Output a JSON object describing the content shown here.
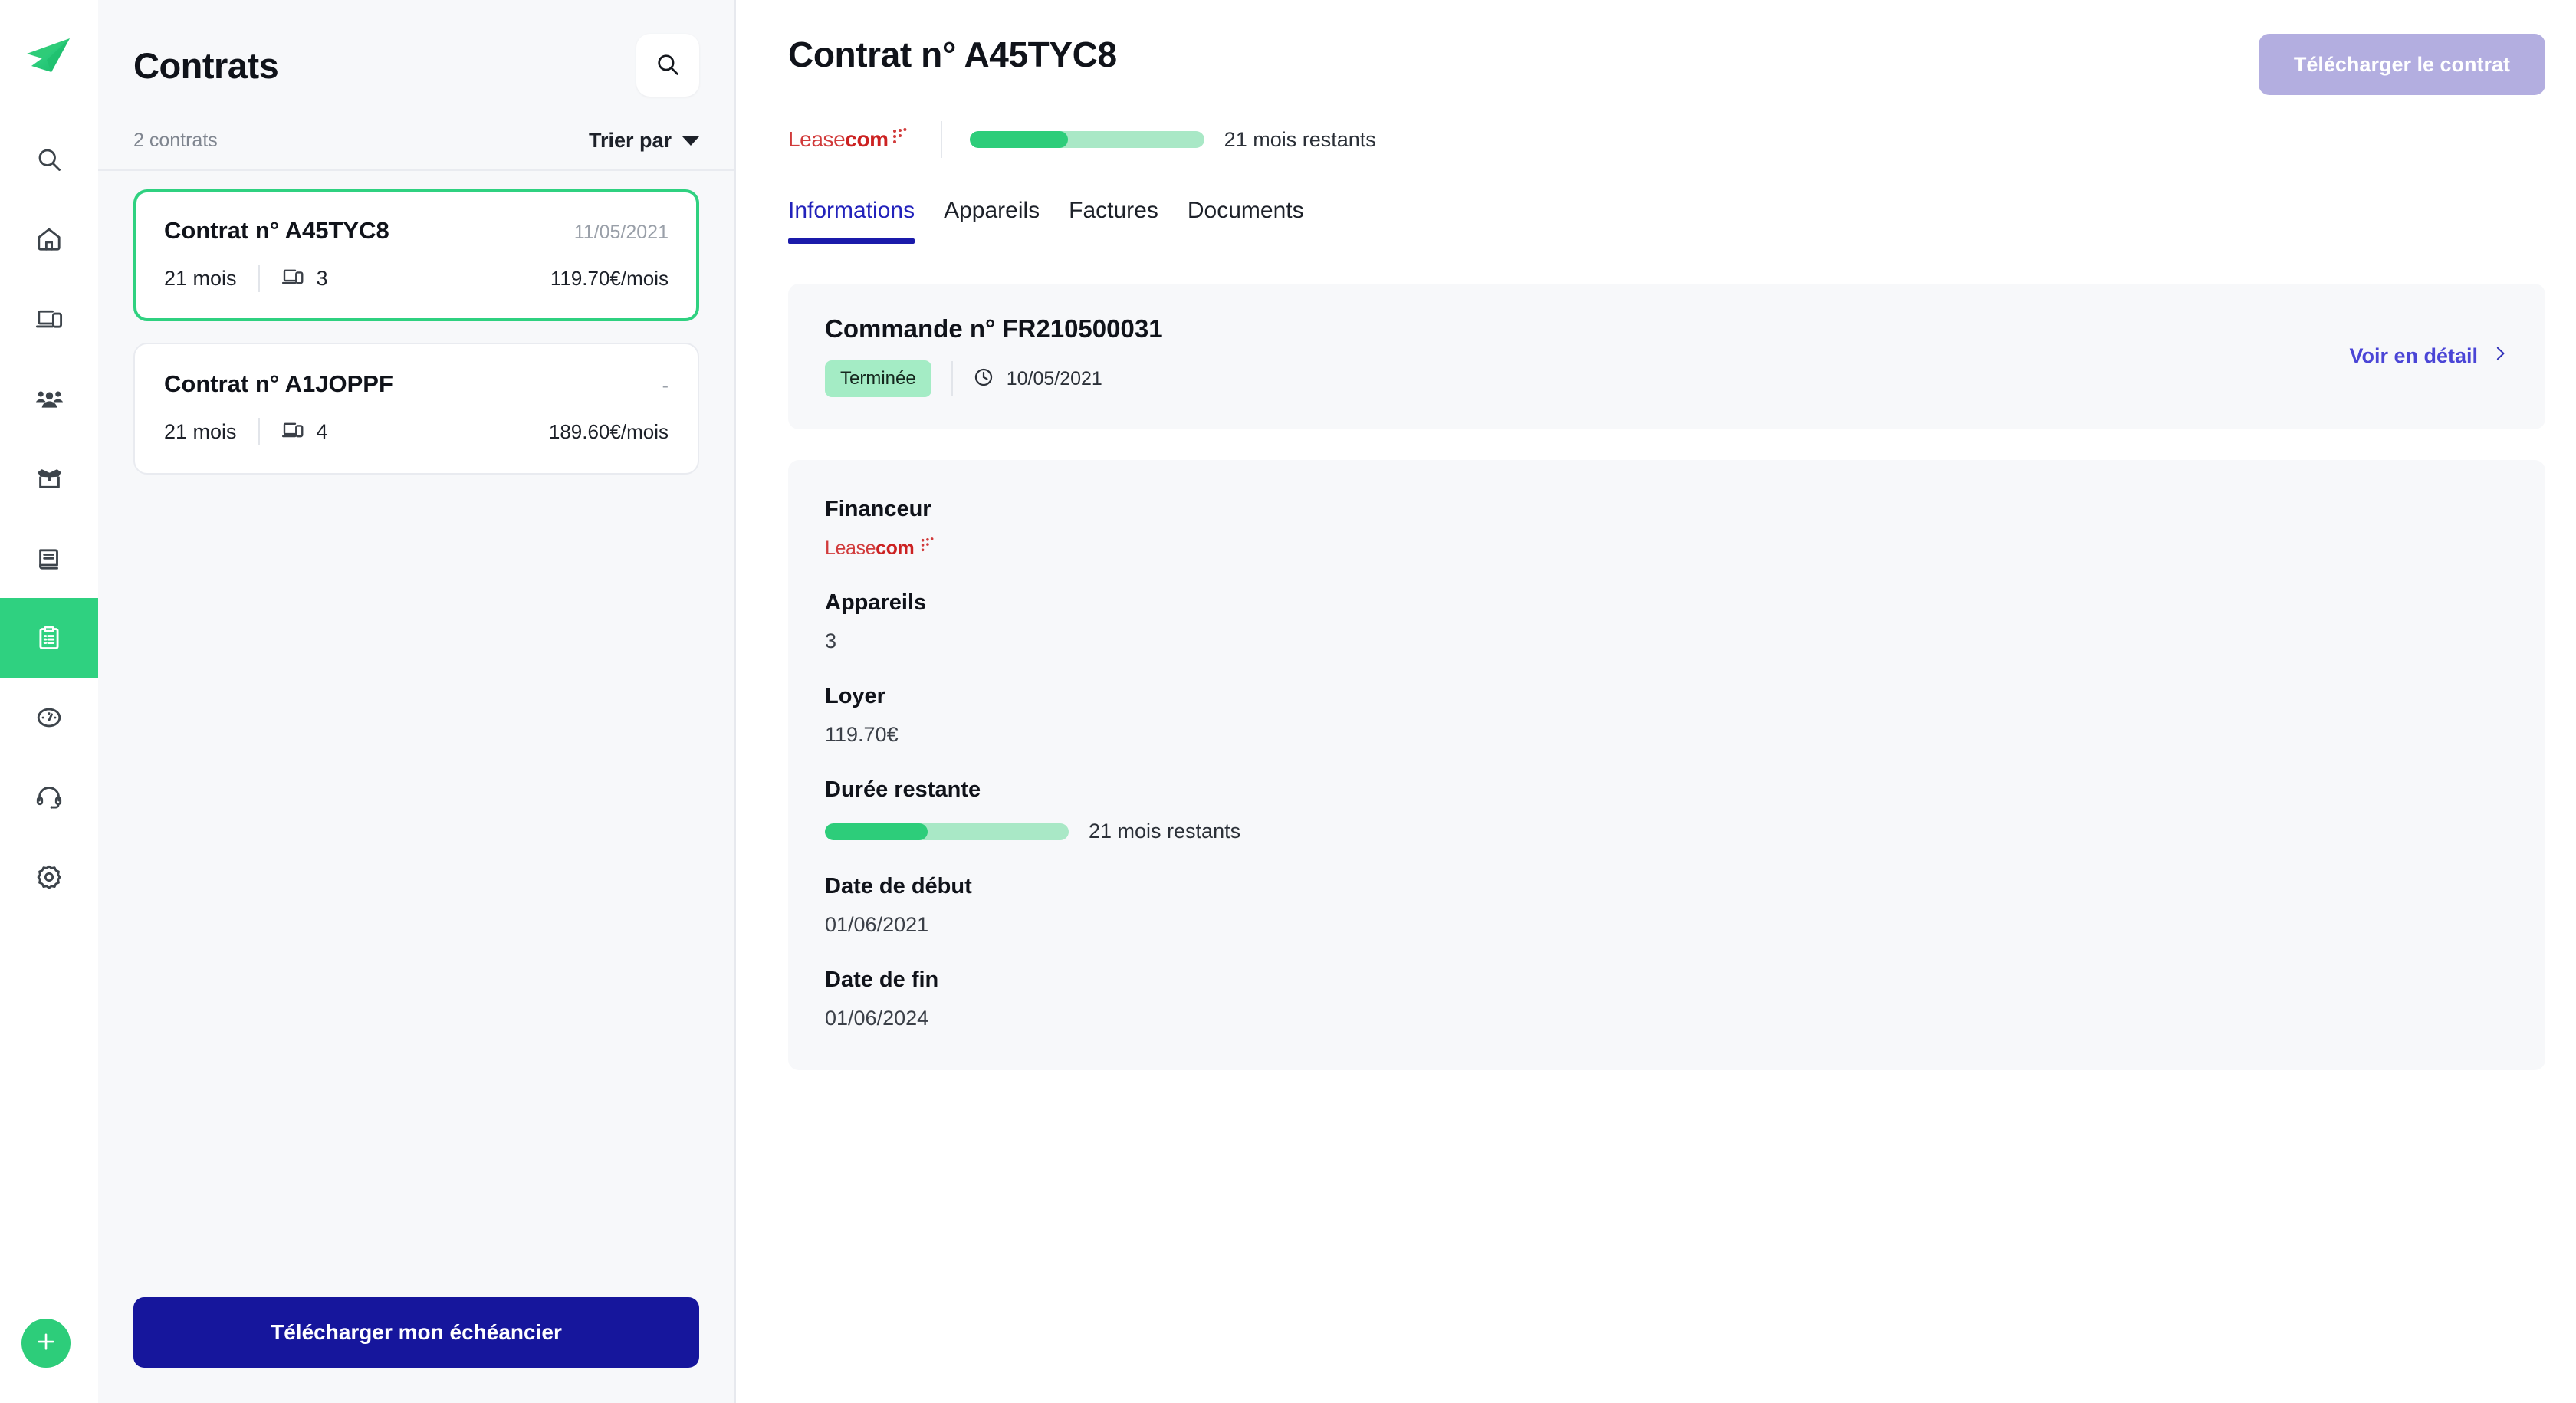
{
  "rail": {
    "logo_name": "fleet-paper-plane-logo",
    "items": [
      {
        "icon": "search-icon",
        "name": "search",
        "active": false
      },
      {
        "icon": "home-icon",
        "name": "home",
        "active": false
      },
      {
        "icon": "devices-icon",
        "name": "devices",
        "active": false
      },
      {
        "icon": "users-icon",
        "name": "users",
        "active": false
      },
      {
        "icon": "open-box-icon",
        "name": "orders",
        "active": false
      },
      {
        "icon": "book-icon",
        "name": "invoices",
        "active": false
      },
      {
        "icon": "clipboard-icon",
        "name": "contracts",
        "active": true
      },
      {
        "icon": "gauge-icon",
        "name": "dashboard",
        "active": false
      },
      {
        "icon": "headset-icon",
        "name": "support",
        "active": false
      },
      {
        "icon": "gear-icon",
        "name": "settings",
        "active": false
      }
    ],
    "fab_icon": "plus-icon"
  },
  "list_panel": {
    "title": "Contrats",
    "search_icon": "search-icon",
    "count_label": "2 contrats",
    "sort_label": "Trier par",
    "footer_button": "Télécharger mon échéancier",
    "contracts": [
      {
        "name": "Contrat n° A45TYC8",
        "date": "11/05/2021",
        "duration": "21 mois",
        "devices": "3",
        "price": "119.70€/mois",
        "selected": true
      },
      {
        "name": "Contrat n° A1JOPPF",
        "date": "-",
        "duration": "21 mois",
        "devices": "4",
        "price": "189.60€/mois",
        "selected": false
      }
    ]
  },
  "main": {
    "title": "Contrat n° A45TYC8",
    "download_button": "Télécharger le contrat",
    "financier_logo_text_light": "Lease",
    "financier_logo_text_bold": "com",
    "progress": {
      "percent": 42,
      "label": "21 mois restants"
    },
    "tabs": [
      {
        "label": "Informations",
        "active": true
      },
      {
        "label": "Appareils",
        "active": false
      },
      {
        "label": "Factures",
        "active": false
      },
      {
        "label": "Documents",
        "active": false
      }
    ],
    "order_card": {
      "title": "Commande n° FR210500031",
      "status_badge": "Terminée",
      "clock_icon": "clock-icon",
      "date": "10/05/2021",
      "detail_link": "Voir en détail",
      "chevron_icon": "chevron-right-icon"
    },
    "info_fields": [
      {
        "label": "Financeur",
        "type": "logo",
        "value": ""
      },
      {
        "label": "Appareils",
        "type": "text",
        "value": "3"
      },
      {
        "label": "Loyer",
        "type": "text",
        "value": "119.70€"
      },
      {
        "label": "Durée restante",
        "type": "progress",
        "value": "21 mois restants"
      },
      {
        "label": "Date de début",
        "type": "text",
        "value": "01/06/2021"
      },
      {
        "label": "Date de fin",
        "type": "text",
        "value": "01/06/2024"
      }
    ]
  },
  "colors": {
    "accent_green": "#2dcd7a",
    "progress_track": "#a9e8c6",
    "primary_blue": "#16169c",
    "link_blue": "#4a45d6",
    "disabled_purple": "#b3aee0",
    "badge_green": "#a4ecc5",
    "leasecom_red": "#d13b3b",
    "panel_bg": "#f7f8fa"
  }
}
